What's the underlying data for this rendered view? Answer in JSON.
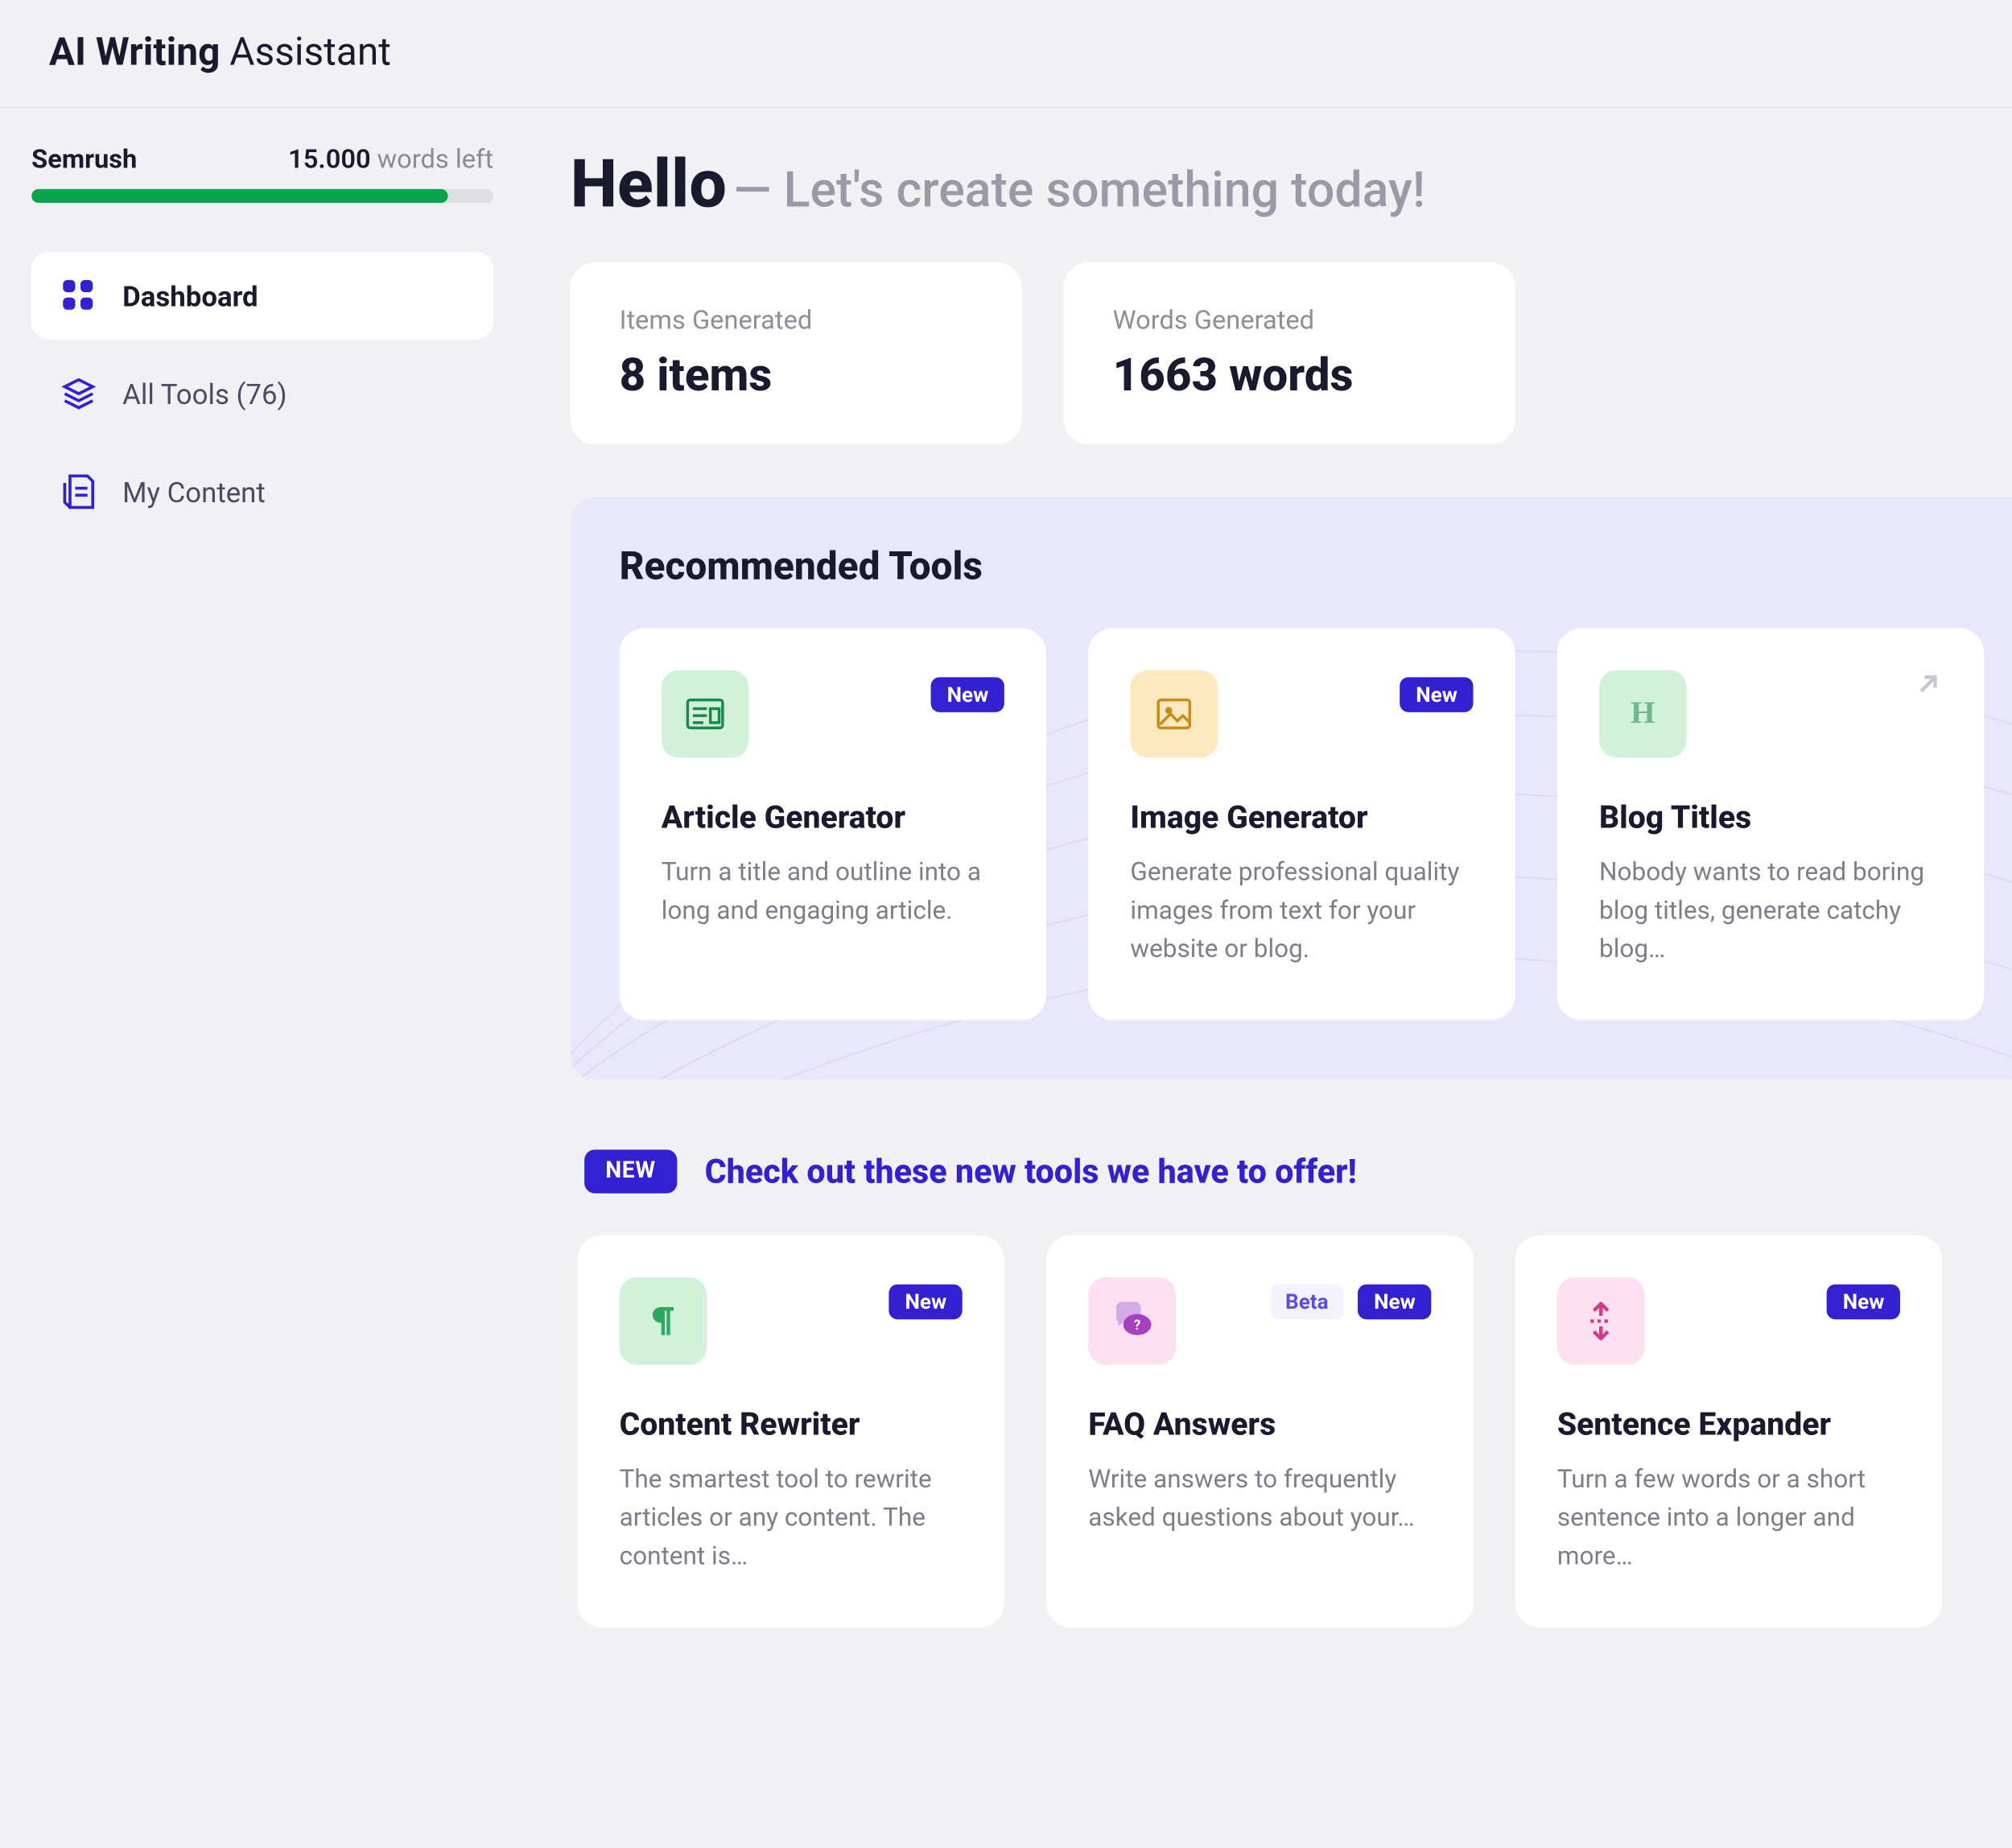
{
  "header": {
    "title_bold": "AI Writing",
    "title_light": " Assistant"
  },
  "sidebar": {
    "account_name": "Semrush",
    "words_count": "15.000",
    "words_suffix": " words left",
    "progress_pct": 90,
    "nav": [
      {
        "label": "Dashboard",
        "icon": "dashboard"
      },
      {
        "label": "All Tools (76)",
        "icon": "tools"
      },
      {
        "label": "My Content",
        "icon": "content"
      }
    ]
  },
  "greeting": {
    "hello": "Hello",
    "subtitle": " — Let's create something today!"
  },
  "stats": [
    {
      "label": "Items Generated",
      "value": "8 items"
    },
    {
      "label": "Words Generated",
      "value": "1663 words"
    }
  ],
  "recommended": {
    "title": "Recommended Tools",
    "tools": [
      {
        "title": "Article Generator",
        "desc": "Turn a title and outline into a long and engaging article.",
        "badge_new": "New",
        "icon_color": "green",
        "icon": "article"
      },
      {
        "title": "Image Generator",
        "desc": "Generate professional quality images from text for your website or blog.",
        "badge_new": "New",
        "icon_color": "amber",
        "icon": "image"
      },
      {
        "title": "Blog Titles",
        "desc": "Nobody wants to read boring blog titles, generate catchy blog…",
        "open_arrow": true,
        "icon_color": "green",
        "icon": "heading"
      }
    ]
  },
  "new_tools": {
    "pill": "NEW",
    "headline": "Check out these new tools we have to offer!",
    "tools": [
      {
        "title": "Content Rewriter",
        "desc": "The smartest tool to rewrite articles or any content. The content is…",
        "badge_new": "New",
        "icon_color": "green",
        "icon": "paragraph"
      },
      {
        "title": "FAQ Answers",
        "desc": "Write answers to frequently asked questions about your…",
        "badge_new": "New",
        "badge_beta": "Beta",
        "icon_color": "pink",
        "icon": "faq"
      },
      {
        "title": "Sentence Expander",
        "desc": "Turn a few words or a short sentence into a longer and more…",
        "badge_new": "New",
        "icon_color": "pink",
        "icon": "expand"
      }
    ]
  }
}
